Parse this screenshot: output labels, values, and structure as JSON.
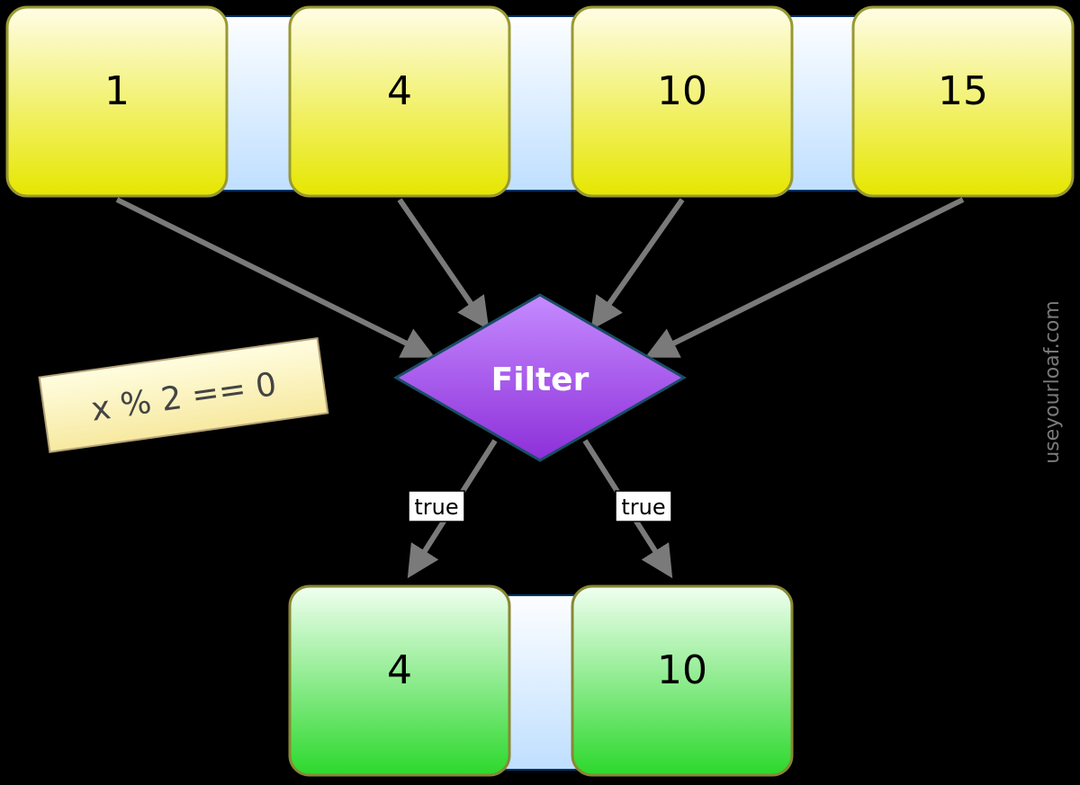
{
  "inputs": [
    "1",
    "4",
    "10",
    "15"
  ],
  "outputs": [
    "4",
    "10"
  ],
  "filter_label": "Filter",
  "condition": "x % 2 == 0",
  "edge_labels": {
    "out1": "true",
    "out2": "true"
  },
  "watermark": "useyourloaf.com",
  "colors": {
    "input_box_top": "#FFFDE6",
    "input_box_bottom": "#E6E600",
    "input_box_stroke": "#999933",
    "output_box_top": "#F0FFF0",
    "output_box_bottom": "#2CD82C",
    "output_box_stroke": "#888833",
    "connector_top": "#FDFEFF",
    "connector_bottom": "#BFDFFF",
    "connector_stroke": "#003366",
    "diamond_top": "#B86CFC",
    "diamond_bottom": "#8D2FD9",
    "diamond_stroke": "#1A4D66",
    "note_top": "#FFFDE0",
    "note_bottom": "#F7E9A0",
    "note_stroke": "#B5A37A",
    "arrow": "#7A7A7A"
  }
}
